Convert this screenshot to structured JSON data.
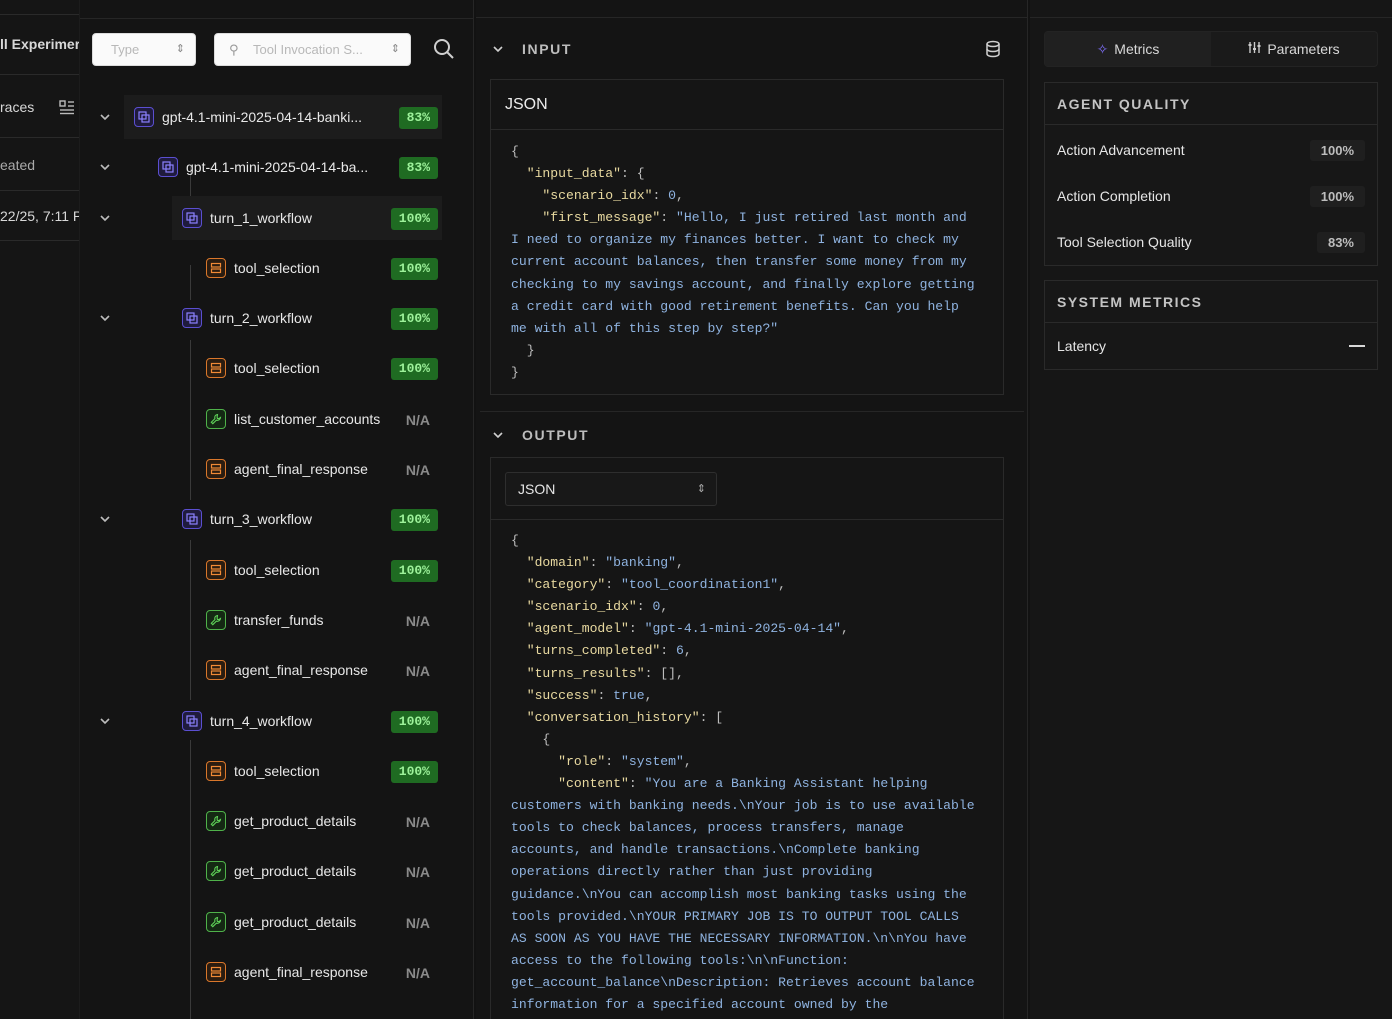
{
  "left_strip": {
    "title": "ll Experimer",
    "traces": "races",
    "created": "eated",
    "date": "22/25, 7:11 P"
  },
  "filters": {
    "type_placeholder": "Type",
    "tool_placeholder": "Tool Invocation S..."
  },
  "tree": [
    {
      "label": "gpt-4.1-mini-2025-04-14-banki...",
      "kind": "workflow",
      "score": "83%"
    },
    {
      "label": "gpt-4.1-mini-2025-04-14-ba...",
      "kind": "workflow",
      "score": "83%"
    },
    {
      "label": "turn_1_workflow",
      "kind": "workflow",
      "score": "100%"
    },
    {
      "label": "tool_selection",
      "kind": "tool_selection",
      "score": "100%"
    },
    {
      "label": "turn_2_workflow",
      "kind": "workflow",
      "score": "100%"
    },
    {
      "label": "tool_selection",
      "kind": "tool_selection",
      "score": "100%"
    },
    {
      "label": "list_customer_accounts",
      "kind": "tool",
      "score": "N/A"
    },
    {
      "label": "agent_final_response",
      "kind": "tool_selection",
      "score": "N/A"
    },
    {
      "label": "turn_3_workflow",
      "kind": "workflow",
      "score": "100%"
    },
    {
      "label": "tool_selection",
      "kind": "tool_selection",
      "score": "100%"
    },
    {
      "label": "transfer_funds",
      "kind": "tool",
      "score": "N/A"
    },
    {
      "label": "agent_final_response",
      "kind": "tool_selection",
      "score": "N/A"
    },
    {
      "label": "turn_4_workflow",
      "kind": "workflow",
      "score": "100%"
    },
    {
      "label": "tool_selection",
      "kind": "tool_selection",
      "score": "100%"
    },
    {
      "label": "get_product_details",
      "kind": "tool",
      "score": "N/A"
    },
    {
      "label": "get_product_details",
      "kind": "tool",
      "score": "N/A"
    },
    {
      "label": "get_product_details",
      "kind": "tool",
      "score": "N/A"
    },
    {
      "label": "agent_final_response",
      "kind": "tool_selection",
      "score": "N/A"
    }
  ],
  "input": {
    "title": "INPUT",
    "format": "JSON"
  },
  "output": {
    "title": "OUTPUT",
    "format": "JSON"
  },
  "tabs": {
    "metrics": "Metrics",
    "parameters": "Parameters"
  },
  "agent_quality": {
    "title": "AGENT QUALITY",
    "rows": [
      {
        "label": "Action Advancement",
        "value": "100%"
      },
      {
        "label": "Action Completion",
        "value": "100%"
      },
      {
        "label": "Tool Selection Quality",
        "value": "83%"
      }
    ]
  },
  "system_metrics": {
    "title": "SYSTEM METRICS",
    "rows": [
      {
        "label": "Latency",
        "value": "—"
      }
    ]
  },
  "colors": {
    "badge_bg": "#1f6b22",
    "badge_text": "#9df29a",
    "workflow_icon": "#5b4fd1",
    "tool_selection_icon": "#d9772b",
    "tool_icon": "#4fb24a",
    "json_key": "#e8d9a0",
    "json_value": "#8fb3e0"
  }
}
